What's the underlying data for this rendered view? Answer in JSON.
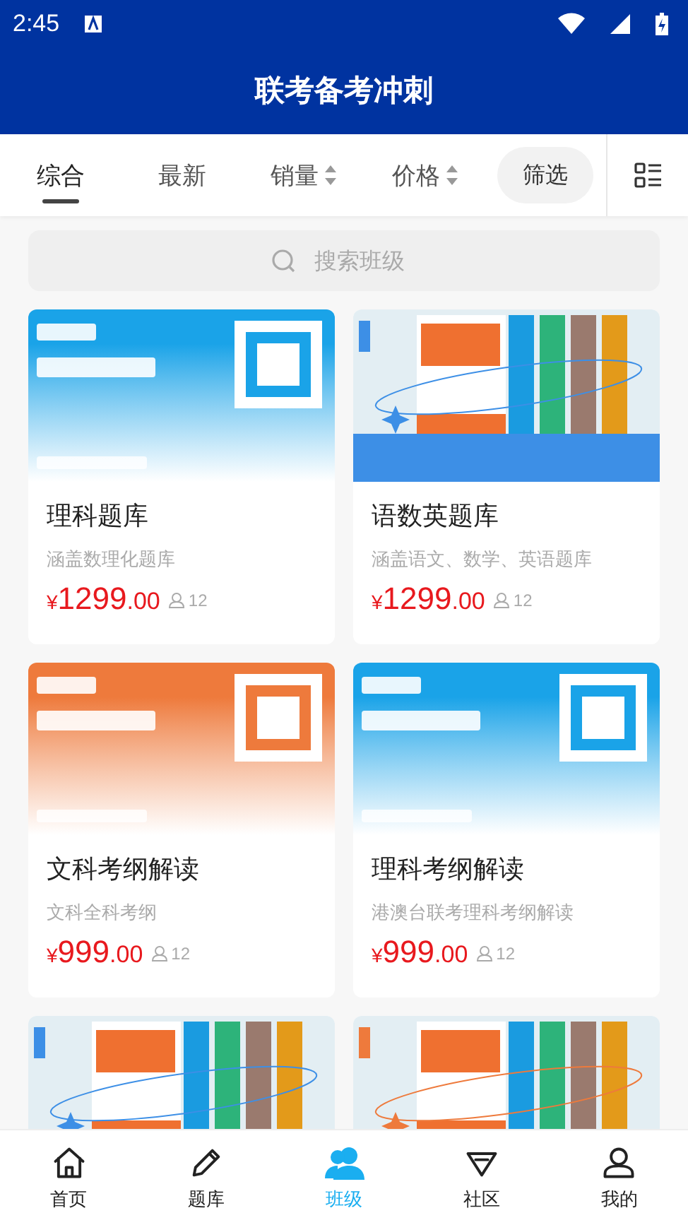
{
  "status_bar": {
    "time": "2:45"
  },
  "header": {
    "title": "联考备考冲刺"
  },
  "tabs": [
    {
      "label": "综合",
      "kind": "plain",
      "selected": true
    },
    {
      "label": "最新",
      "kind": "plain",
      "selected": false
    },
    {
      "label": "销量",
      "kind": "sort",
      "selected": false
    },
    {
      "label": "价格",
      "kind": "sort",
      "selected": false
    }
  ],
  "filter_button": "筛选",
  "search": {
    "placeholder": "搜索班级"
  },
  "courses": [
    {
      "cover": {
        "kind": "banner",
        "color": "#1aa3e8"
      },
      "title": "理科题库",
      "subtitle": "涵盖数理化题库",
      "currency": "¥",
      "price": "1299",
      "cents": ".00",
      "members": "12"
    },
    {
      "cover": {
        "kind": "books",
        "color": "#3d8fe6"
      },
      "title": "语数英题库",
      "subtitle": "涵盖语文、数学、英语题库",
      "currency": "¥",
      "price": "1299",
      "cents": ".00",
      "members": "12"
    },
    {
      "cover": {
        "kind": "banner",
        "color": "#ee7a3c"
      },
      "title": "文科考纲解读",
      "subtitle": "文科全科考纲",
      "currency": "¥",
      "price": "999",
      "cents": ".00",
      "members": "12"
    },
    {
      "cover": {
        "kind": "banner",
        "color": "#1aa3e8"
      },
      "title": "理科考纲解读",
      "subtitle": "港澳台联考理科考纲解读",
      "currency": "¥",
      "price": "999",
      "cents": ".00",
      "members": "12"
    },
    {
      "cover": {
        "kind": "books",
        "color": "#3d8fe6"
      }
    },
    {
      "cover": {
        "kind": "books",
        "color": "#ee7a3c"
      }
    }
  ],
  "bottom_nav": [
    {
      "label": "首页",
      "selected": false
    },
    {
      "label": "题库",
      "selected": false
    },
    {
      "label": "班级",
      "selected": true
    },
    {
      "label": "社区",
      "selected": false
    },
    {
      "label": "我的",
      "selected": false
    }
  ]
}
